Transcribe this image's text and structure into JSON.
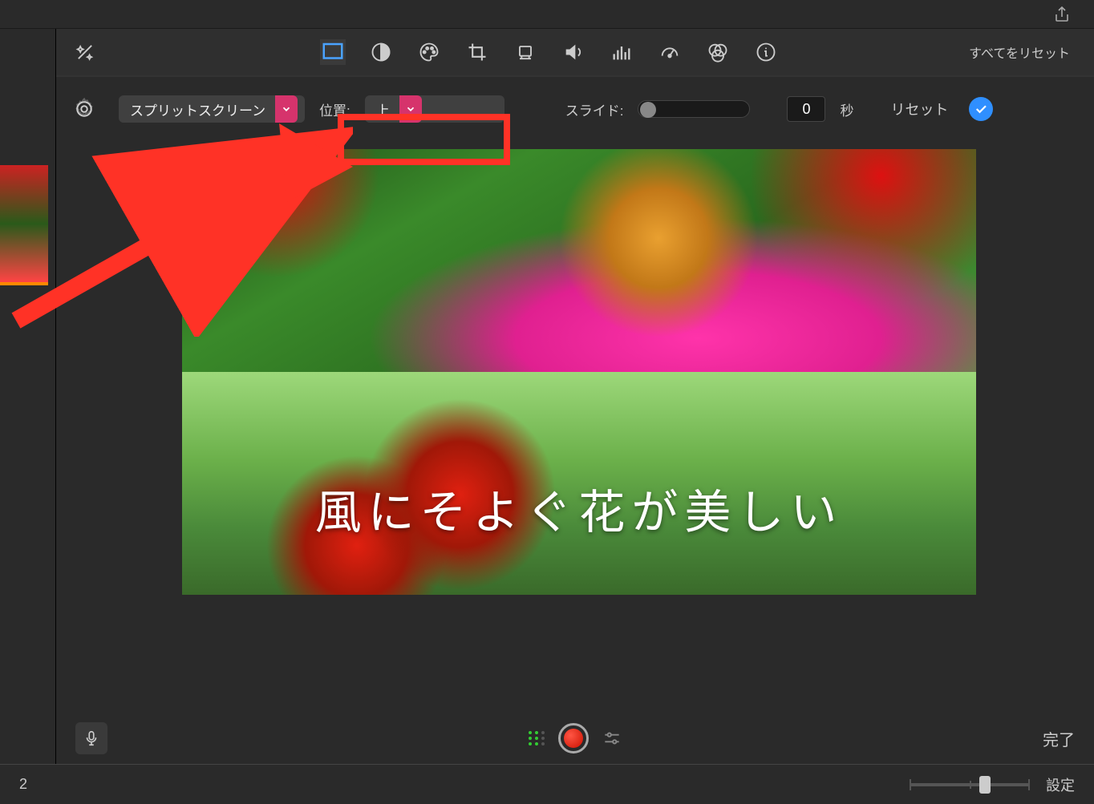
{
  "titlebar": {
    "share_icon": "share-icon"
  },
  "inspector": {
    "tools": {
      "magic": "magic-wand-icon",
      "overlay": "overlay-icon",
      "contrast": "contrast-icon",
      "color": "color-palette-icon",
      "crop": "crop-icon",
      "camera": "camera-icon",
      "volume": "volume-icon",
      "eq": "equalizer-icon",
      "speed": "speedometer-icon",
      "filters": "filters-icon",
      "info": "info-icon"
    },
    "reset_all_label": "すべてをリセット"
  },
  "controls": {
    "gear_icon": "gear-icon",
    "split_screen_label": "スプリットスクリーン",
    "position_label": "位置:",
    "position_value": "上",
    "slide_label": "スライド:",
    "slide_value": "0",
    "seconds_label": "秒",
    "reset_label": "リセット"
  },
  "preview": {
    "caption": "風にそよぐ花が美しい"
  },
  "preview_bar": {
    "mic_icon": "microphone-icon",
    "record_icon": "record-button",
    "adjust_icon": "adjust-sliders-icon",
    "done_label": "完了"
  },
  "footer": {
    "value": "2",
    "settings_label": "設定"
  },
  "annotation": {
    "arrow_target": "position-dropdown"
  }
}
